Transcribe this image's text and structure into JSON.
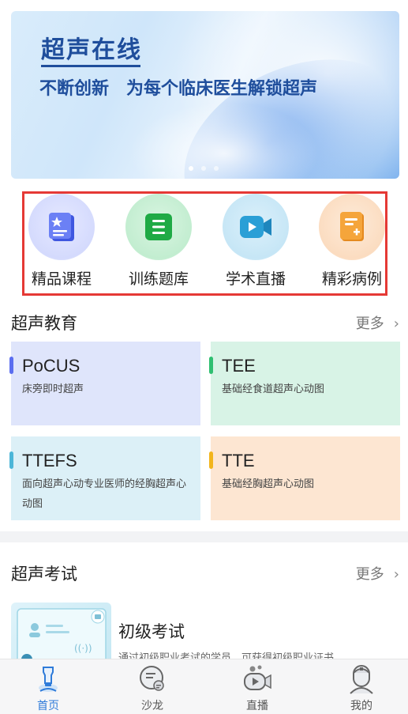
{
  "banner": {
    "title": "超声在线",
    "slogan_part1": "不断创新",
    "slogan_part2": "为每个临床医生解锁超声",
    "slide_count": 3,
    "active_slide": 1
  },
  "quicknav": [
    {
      "label": "精品课程",
      "icon": "star-book-icon",
      "color": "#5b6ef0"
    },
    {
      "label": "训练题库",
      "icon": "list-doc-icon",
      "color": "#27b34d"
    },
    {
      "label": "学术直播",
      "icon": "video-camera-icon",
      "color": "#2aa0d6"
    },
    {
      "label": "精彩病例",
      "icon": "medical-record-icon",
      "color": "#f29a2e"
    }
  ],
  "education": {
    "title": "超声教育",
    "more": "更多",
    "cards": [
      {
        "title": "PoCUS",
        "desc": "床旁即时超声",
        "accent": "#5b6ef0",
        "bg": "#dfe5fb"
      },
      {
        "title": "TEE",
        "desc": "基础经食道超声心动图",
        "accent": "#2fbf71",
        "bg": "#d8f3e6"
      },
      {
        "title": "TTEFS",
        "desc": "面向超声心动专业医师的经胸超声心动图",
        "accent": "#4cb6d8",
        "bg": "#dcf0f7"
      },
      {
        "title": "TTE",
        "desc": "基础经胸超声心动图",
        "accent": "#f2b51c",
        "bg": "#fde6d2"
      }
    ]
  },
  "exam": {
    "title": "超声考试",
    "more": "更多",
    "item_title": "初级考试",
    "item_desc": "通过初级职业考试的学员，可获得初级职业证书"
  },
  "tabbar": [
    {
      "label": "首页",
      "icon": "home-probe-icon",
      "active": true
    },
    {
      "label": "沙龙",
      "icon": "chat-bubble-icon",
      "active": false
    },
    {
      "label": "直播",
      "icon": "live-camera-icon",
      "active": false
    },
    {
      "label": "我的",
      "icon": "doctor-avatar-icon",
      "active": false
    }
  ]
}
